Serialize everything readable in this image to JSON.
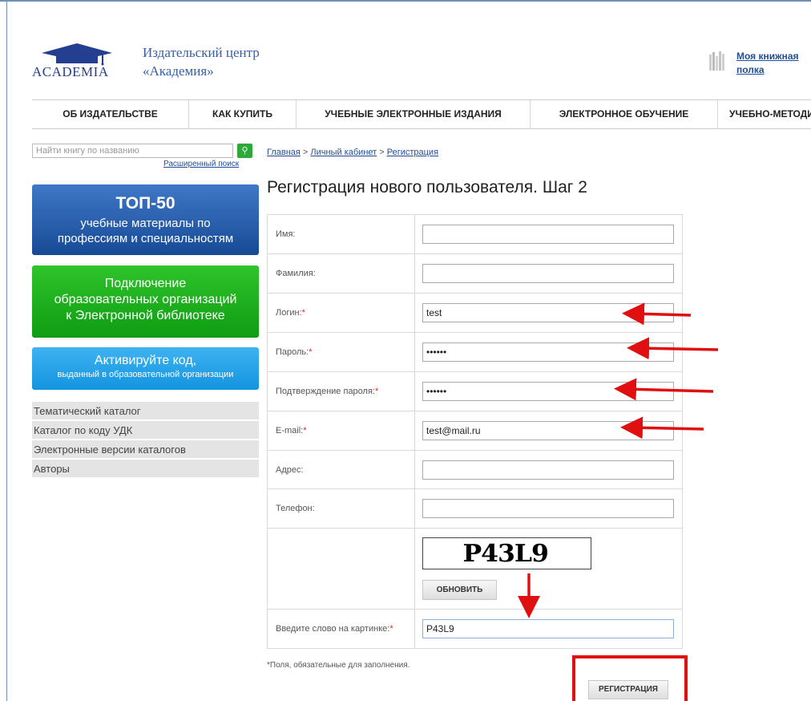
{
  "header": {
    "logo_text": "ACADEMIA",
    "publisher_line1": "Издательский центр",
    "publisher_line2": "«Академия»",
    "shelf_line1": "Моя книжная",
    "shelf_line2": "полка"
  },
  "nav": {
    "items": [
      {
        "label": "ОБ ИЗДАТЕЛЬСТВЕ"
      },
      {
        "label": "КАК КУПИТЬ"
      },
      {
        "label": "УЧЕБНЫЕ ЭЛЕКТРОННЫЕ ИЗДАНИЯ"
      },
      {
        "label": "ЭЛЕКТРОННОЕ ОБУЧЕНИЕ"
      },
      {
        "label": "УЧЕБНО-МЕТОДИЧЕСКОЕ"
      }
    ]
  },
  "sidebar": {
    "search_placeholder": "Найти книгу по названию",
    "advanced_search": "Расширенный поиск",
    "promo_top50_title": "ТОП-50",
    "promo_top50_line1": "учебные материалы по",
    "promo_top50_line2": "профессиям и специальностям",
    "promo_connect_line1": "Подключение",
    "promo_connect_line2": "образовательных организаций",
    "promo_connect_line3": "к Электронной библиотеке",
    "promo_activate_title": "Активируйте код,",
    "promo_activate_sub": "выданный в образовательной организации",
    "catalog": [
      {
        "label": "Тематический каталог"
      },
      {
        "label": "Каталог по коду УДК"
      },
      {
        "label": "Электронные версии каталогов"
      },
      {
        "label": "Авторы"
      }
    ]
  },
  "breadcrumb": {
    "home": "Главная",
    "sep1": " > ",
    "cabinet": "Личный кабинет",
    "sep2": " > ",
    "current": "Регистрация"
  },
  "page_title": "Регистрация нового пользователя. Шаг 2",
  "form": {
    "first_name": {
      "label": "Имя:",
      "value": ""
    },
    "last_name": {
      "label": "Фамилия:",
      "value": ""
    },
    "login": {
      "label": "Логин:",
      "value": "test"
    },
    "password": {
      "label": "Пароль:",
      "value": "••••••"
    },
    "password_confirm": {
      "label": "Подтверждение пароля:",
      "value": "••••••"
    },
    "email": {
      "label": "E-mail:",
      "value": "test@mail.ru"
    },
    "address": {
      "label": "Адрес:",
      "value": ""
    },
    "phone": {
      "label": "Телефон:",
      "value": ""
    },
    "captcha_text": "P43L9",
    "refresh_label": "ОБНОВИТЬ",
    "captcha_input": {
      "label": "Введите слово на картинке:",
      "value": "P43L9"
    },
    "required_asterisk": "*",
    "required_note": "*Поля, обязательные для заполнения.",
    "register_label": "РЕГИСТРАЦИЯ"
  },
  "colors": {
    "accent_blue": "#1f4e9a",
    "annotation_red": "#e01010",
    "promo_green": "#0f9c13"
  }
}
